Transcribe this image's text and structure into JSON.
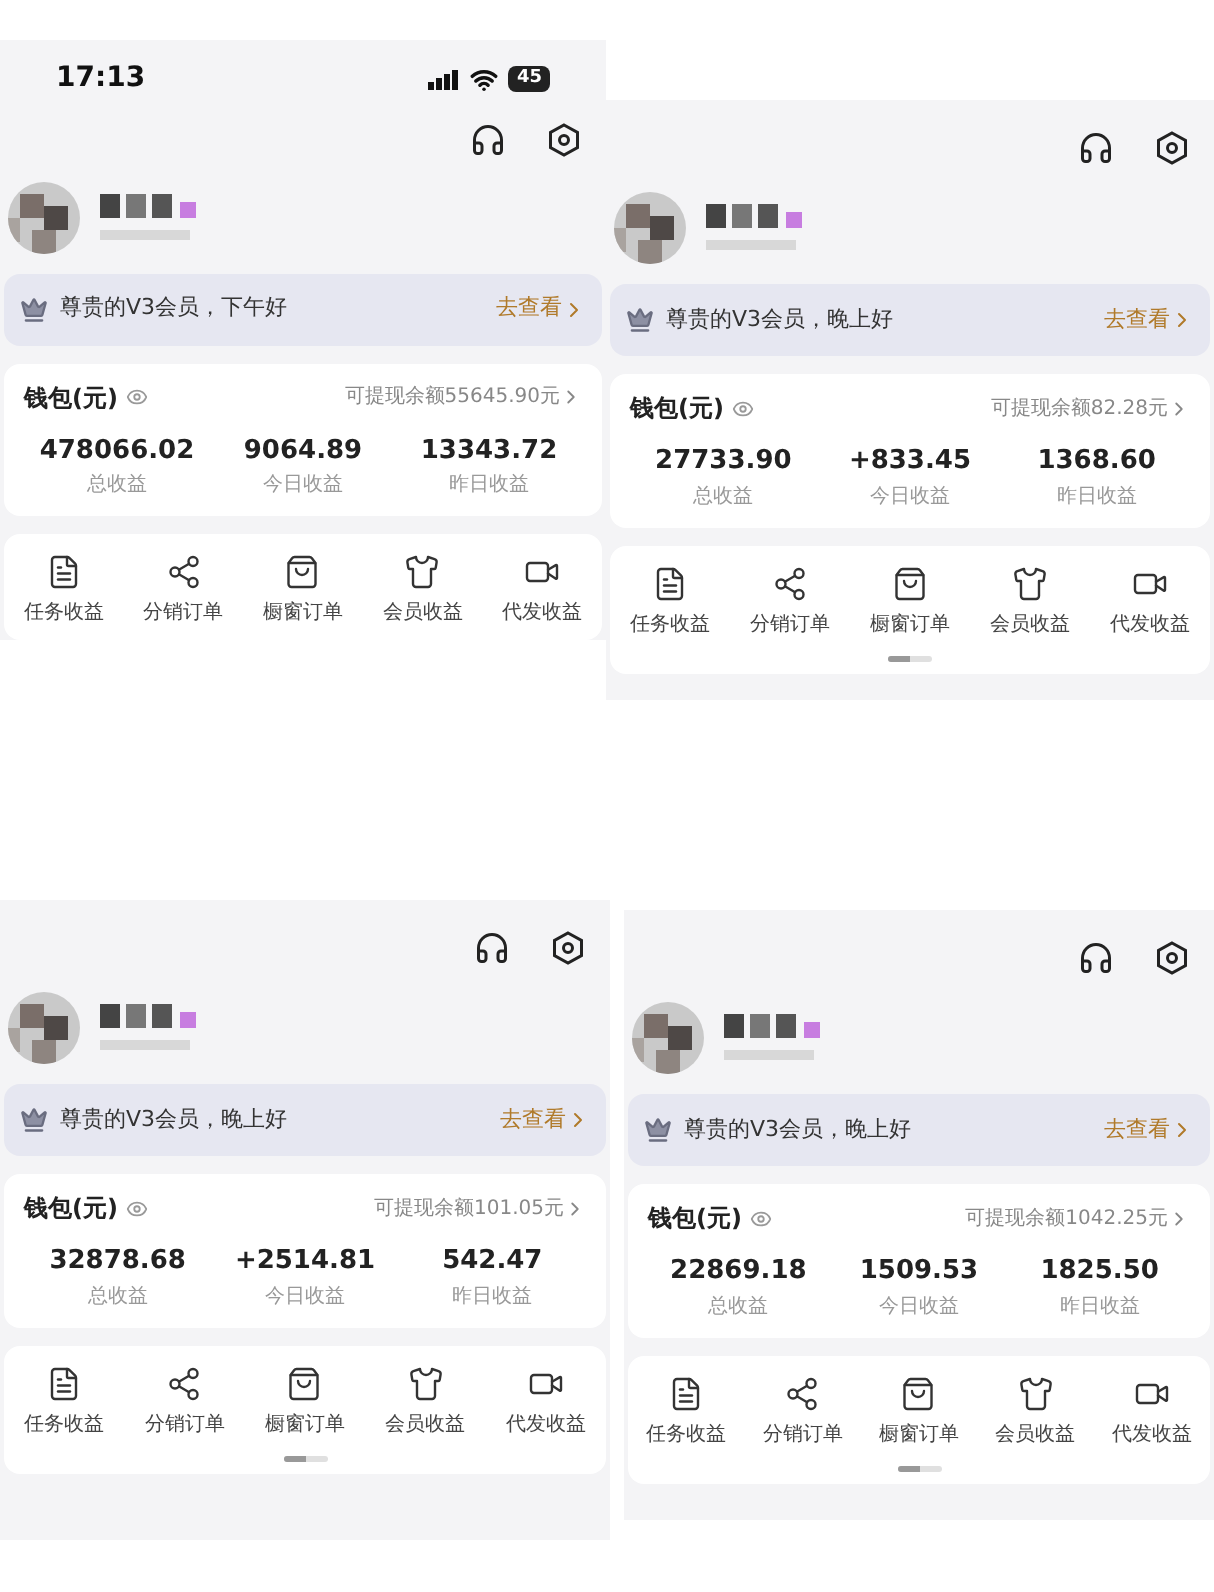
{
  "panels": [
    {
      "status_bar": {
        "time": "17:13",
        "battery": "45"
      },
      "greeting": "尊贵的V3会员，下午好",
      "view_link": "去查看",
      "wallet": {
        "title": "钱包(元)",
        "balance": "可提现余额55645.90元",
        "stats": [
          {
            "value": "478066.02",
            "label": "总收益"
          },
          {
            "value": "9064.89",
            "label": "今日收益"
          },
          {
            "value": "13343.72",
            "label": "昨日收益"
          }
        ]
      },
      "menu": [
        "任务收益",
        "分销订单",
        "橱窗订单",
        "会员收益",
        "代发收益"
      ],
      "page_indicator": false
    },
    {
      "greeting": "尊贵的V3会员，晚上好",
      "view_link": "去查看",
      "wallet": {
        "title": "钱包(元)",
        "balance": "可提现余额82.28元",
        "stats": [
          {
            "value": "27733.90",
            "label": "总收益"
          },
          {
            "value": "+833.45",
            "label": "今日收益"
          },
          {
            "value": "1368.60",
            "label": "昨日收益"
          }
        ]
      },
      "menu": [
        "任务收益",
        "分销订单",
        "橱窗订单",
        "会员收益",
        "代发收益"
      ],
      "page_indicator": true
    },
    {
      "greeting": "尊贵的V3会员，晚上好",
      "view_link": "去查看",
      "wallet": {
        "title": "钱包(元)",
        "balance": "可提现余额101.05元",
        "stats": [
          {
            "value": "32878.68",
            "label": "总收益"
          },
          {
            "value": "+2514.81",
            "label": "今日收益"
          },
          {
            "value": "542.47",
            "label": "昨日收益"
          }
        ]
      },
      "menu": [
        "任务收益",
        "分销订单",
        "橱窗订单",
        "会员收益",
        "代发收益"
      ],
      "page_indicator": true
    },
    {
      "greeting": "尊贵的V3会员，晚上好",
      "view_link": "去查看",
      "wallet": {
        "title": "钱包(元)",
        "balance": "可提现余额1042.25元",
        "stats": [
          {
            "value": "22869.18",
            "label": "总收益"
          },
          {
            "value": "1509.53",
            "label": "今日收益"
          },
          {
            "value": "1825.50",
            "label": "昨日收益"
          }
        ]
      },
      "menu": [
        "任务收益",
        "分销订单",
        "橱窗订单",
        "会员收益",
        "代发收益"
      ],
      "page_indicator": true
    }
  ]
}
